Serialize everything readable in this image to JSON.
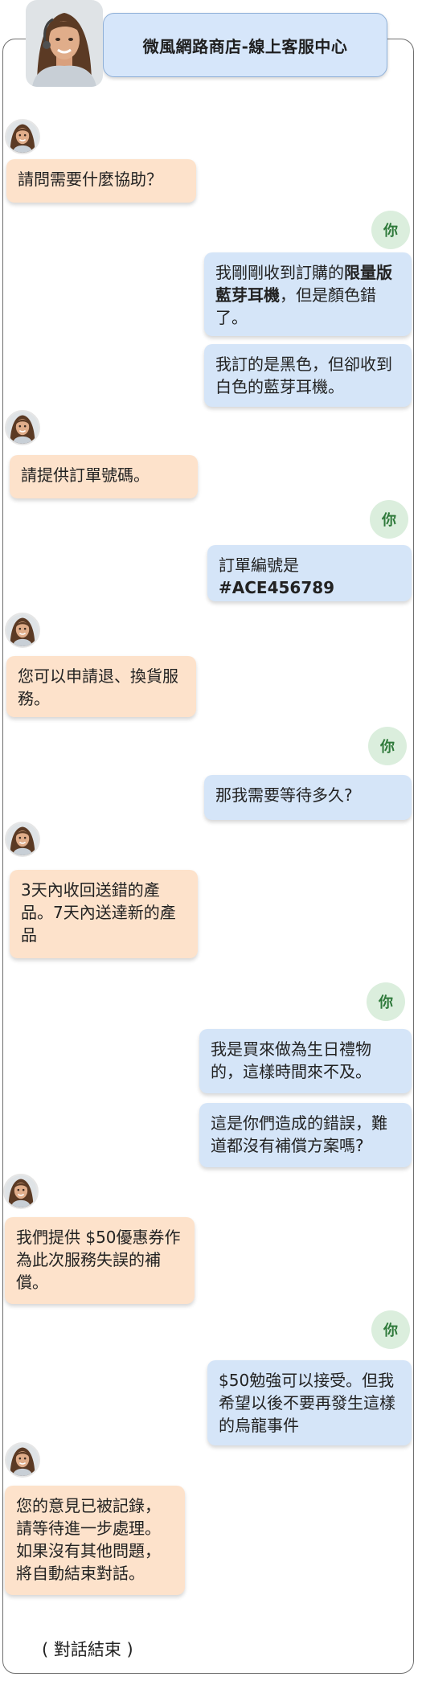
{
  "header": {
    "title": "微風網路商店-線上客服中心"
  },
  "you_label": "你",
  "messages": {
    "m1": "請問需要什麼協助？",
    "m2a": "我剛剛收到訂購的",
    "m2b": "限量版藍芽耳機",
    "m2c": "，但是顏色錯了。",
    "m3": "我訂的是黑色，但卻收到白色的藍芽耳機。",
    "m4": "請提供訂單號碼。",
    "m5a": "訂單編號是",
    "m5b": "#ACE456789",
    "m6": "您可以申請退、換貨服務。",
    "m7": "那我需要等待多久?",
    "m8": "3天內收回送錯的產品。7天內送達新的產品",
    "m9": "我是買來做為生日禮物的，這樣時間來不及。",
    "m10": "這是你們造成的錯誤，難道都沒有補償方案嗎?",
    "m11": "我們提供 $50優惠券作為此次服務失誤的補償。",
    "m12": "$50勉強可以接受。但我希望以後不要再發生這樣的烏龍事件",
    "m13": "您的意見已被記錄，請等待進一步處理。如果沒有其他問題，將自動結束對話。"
  },
  "end_note": "( 對話結束 )",
  "colors": {
    "agent_bubble": "#fde2cb",
    "user_bubble": "#d5e5f8",
    "header_bg": "#d6e6fa",
    "you_badge_bg": "#dbeedd",
    "you_badge_text": "#2f7a3b"
  },
  "icons": {
    "agent_avatar": "agent-avatar",
    "header_avatar": "support-agent-portrait"
  }
}
